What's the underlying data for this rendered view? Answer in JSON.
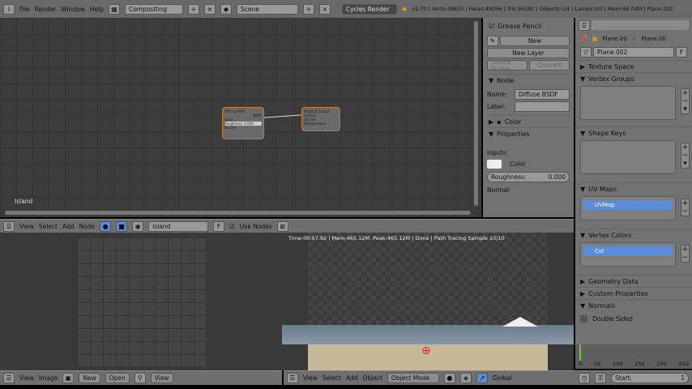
{
  "topbar": {
    "menus": [
      "File",
      "Render",
      "Window",
      "Help"
    ],
    "layout": "Compositing",
    "scene": "Scene",
    "engine": "Cycles Render",
    "stats": "v2.70 | Verts:48825 | Faces:48096 | Tris:96192 | Objects:1/4 | Lamps:0/0 | Mem:46.04M | Plane.002"
  },
  "node_editor": {
    "label": "Island",
    "nodes": [
      {
        "title": "Diffuse BSDF",
        "output": "BSDF",
        "inputs": [
          "Color",
          "Roughness: 0.000",
          "Normal"
        ]
      },
      {
        "title": "Material Output",
        "inputs": [
          "Surface",
          "Volume",
          "Displacement"
        ]
      }
    ],
    "header": {
      "menus": [
        "View",
        "Select",
        "Add",
        "Node"
      ],
      "material": "Island",
      "fake_user": "F",
      "use_nodes": "Use Nodes"
    }
  },
  "npanel": {
    "grease_pencil": "Grease Pencil",
    "new": "New",
    "new_layer": "New Layer",
    "delete_frame": "Delete Frame",
    "convert": "Convert",
    "node_section": "Node",
    "name_label": "Name:",
    "name_value": "Diffuse BSDF",
    "label_label": "Label:",
    "color_section": "Color",
    "properties_section": "Properties",
    "inputs_label": "Inputs:",
    "color_label": "Color",
    "roughness_label": "Roughness:",
    "roughness_value": "0.000",
    "normal_label": "Normal"
  },
  "properties": {
    "breadcrumb": [
      "Plane.00",
      "Plane.00"
    ],
    "mesh_name": "Plane.002",
    "fake_user": "F",
    "sections": {
      "texture_space": "Texture Space",
      "vertex_groups": "Vertex Groups",
      "shape_keys": "Shape Keys",
      "uv_maps": "UV Maps",
      "vertex_colors": "Vertex Colors",
      "geometry_data": "Geometry Data",
      "custom_properties": "Custom Properties",
      "normals": "Normals"
    },
    "uv_map": "UVMap",
    "vertex_color": "Col",
    "double_sided": "Double Sided"
  },
  "timeline": {
    "ticks": [
      "0",
      "50",
      "100",
      "150",
      "200",
      "250"
    ],
    "start_label": "Start:",
    "start_value": "1"
  },
  "viewport": {
    "render_info": "Time:00:07.92 | Mem:465.12M, Peak:465.12M | Done | Path Tracing Sample 10/10",
    "menus": [
      "View",
      "Select",
      "Add",
      "Object"
    ],
    "mode": "Object Mode",
    "orientation": "Global"
  },
  "image_editor": {
    "menus": [
      "View",
      "Image"
    ],
    "new": "New",
    "open": "Open",
    "view": "View"
  }
}
